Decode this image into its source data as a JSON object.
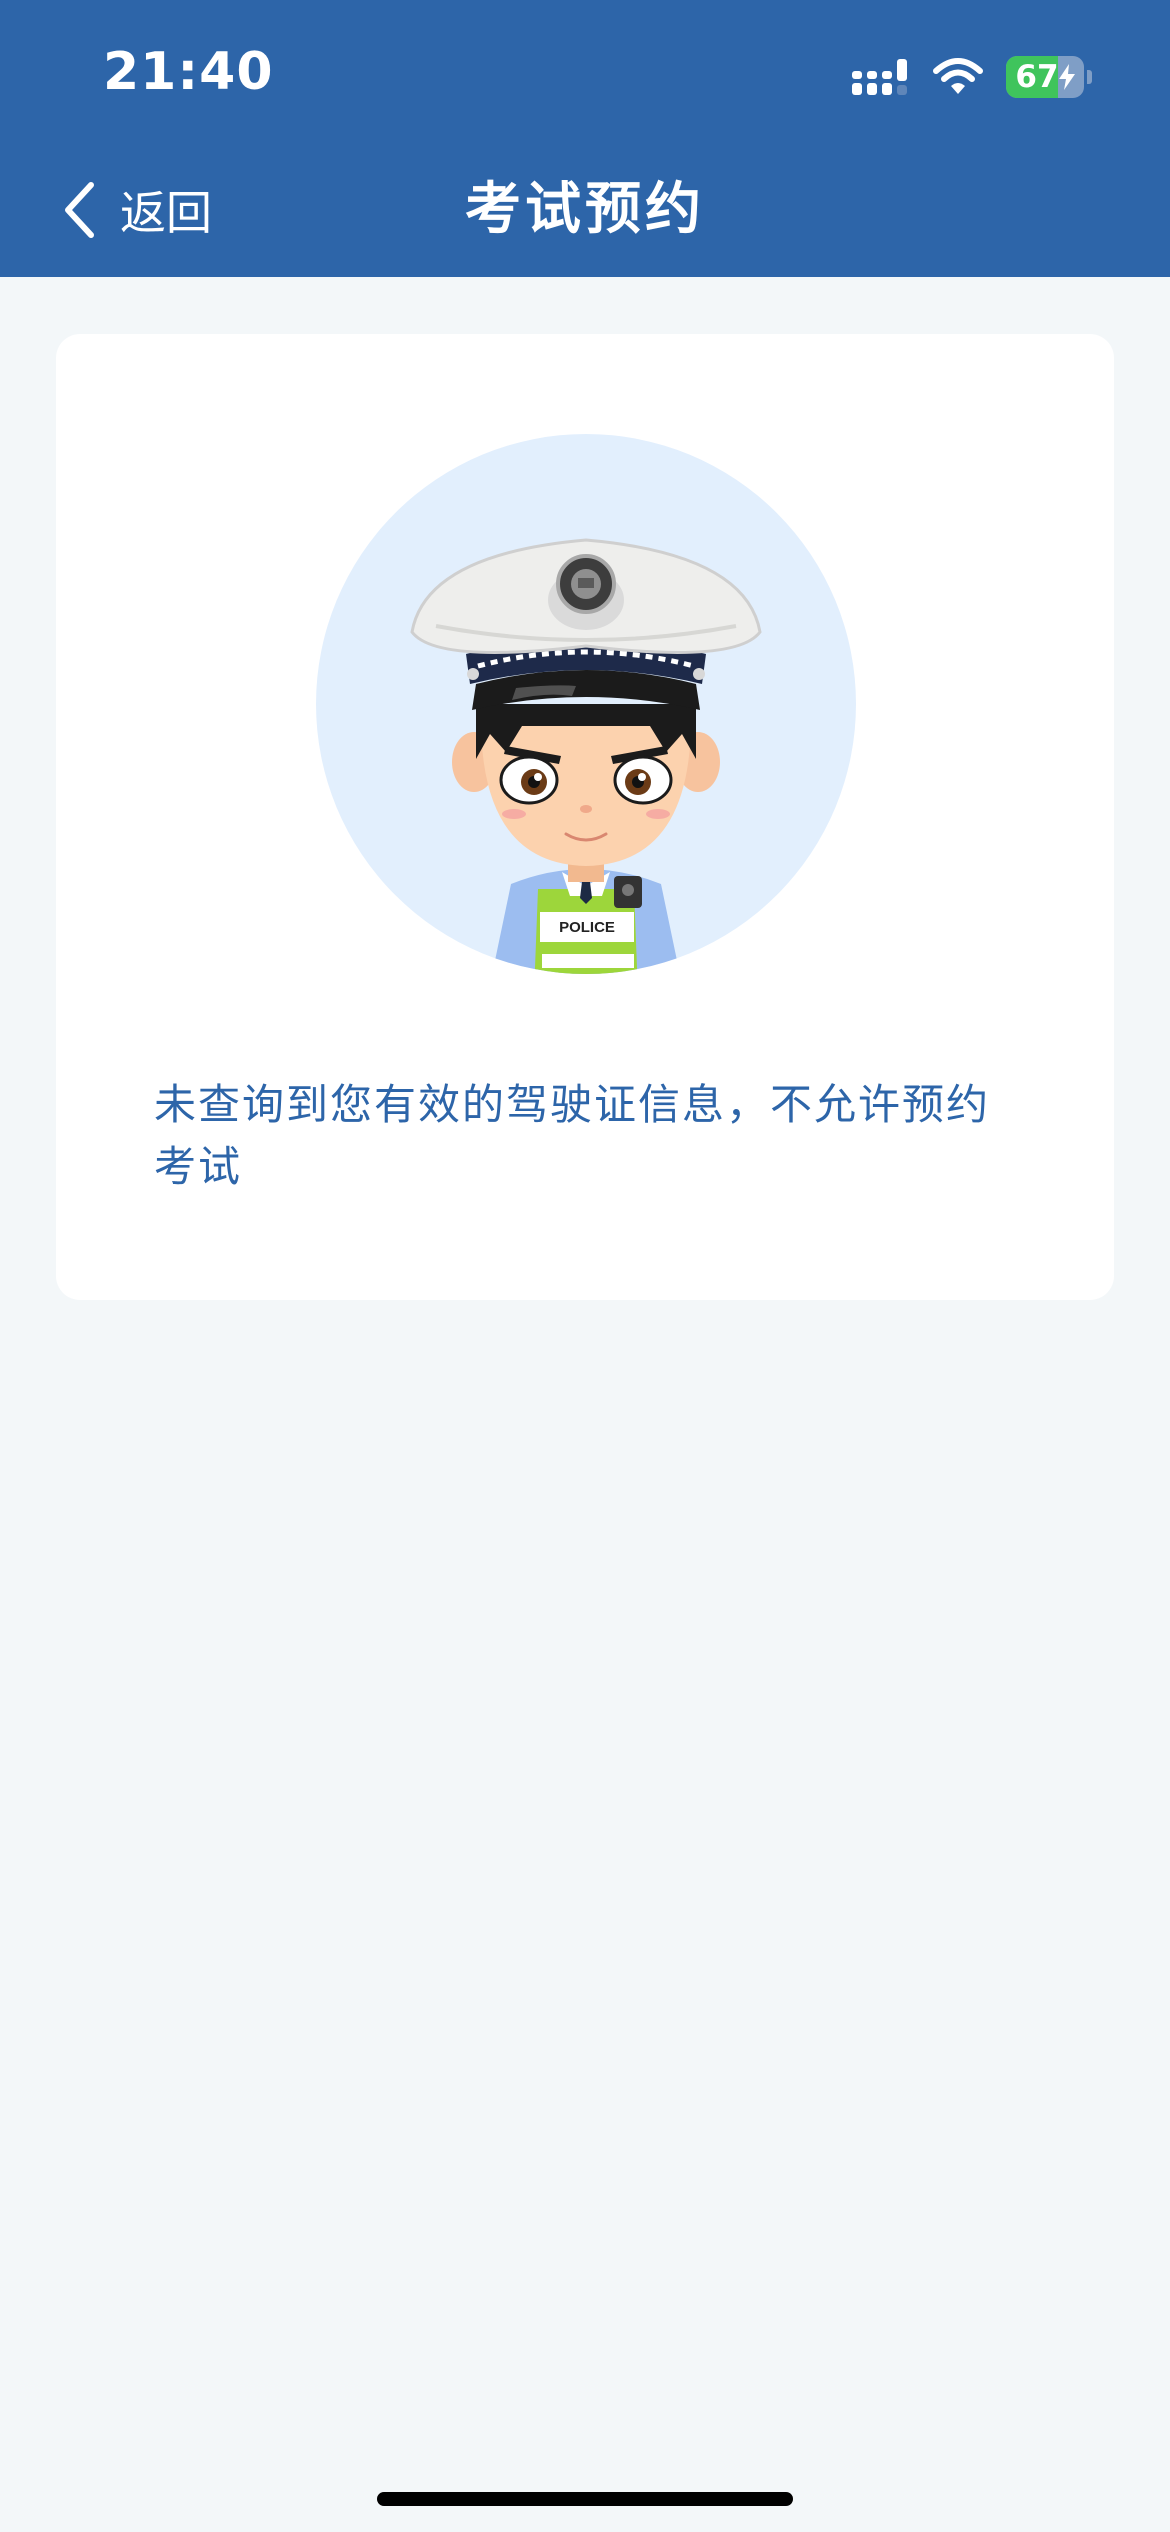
{
  "status_bar": {
    "time": "21:40",
    "battery": "67",
    "battery_level": 0.67
  },
  "nav": {
    "back_label": "返回",
    "title": "考试预约"
  },
  "card": {
    "avatar_label": "POLICE",
    "message": "未查询到您有效的驾驶证信息，不允许预约考试"
  },
  "colors": {
    "header": "#2d65a9",
    "background": "#f3f7f9",
    "message_text": "#2d65a9",
    "avatar_circle": "#e2effd"
  }
}
